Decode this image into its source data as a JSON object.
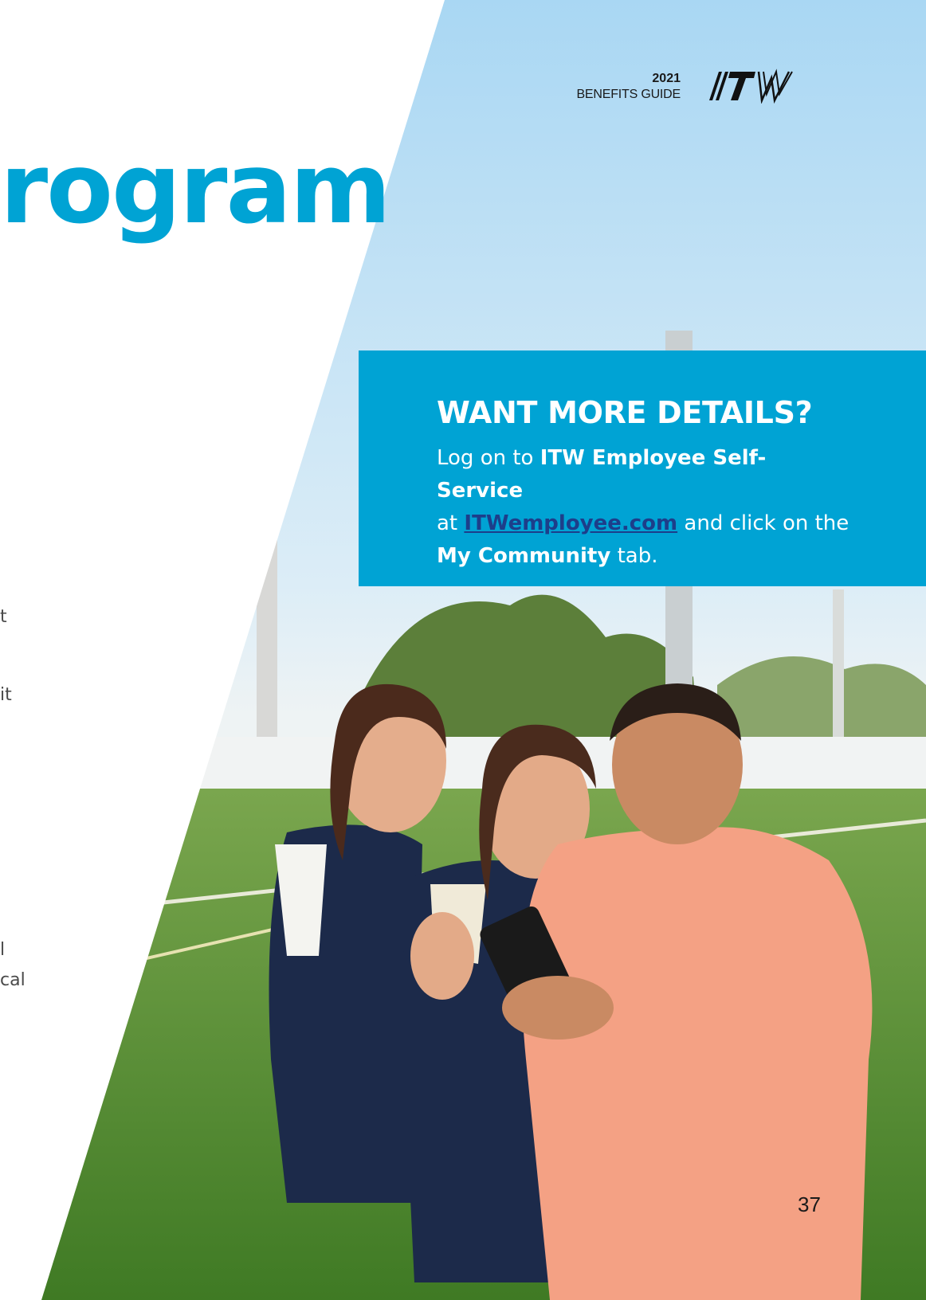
{
  "header": {
    "year": "2021",
    "guide_label": "BENEFITS GUIDE",
    "logo_text": "ITW"
  },
  "title_fragment": "rogram",
  "left_column_fragments": [
    "t",
    "l",
    "cal",
    "it"
  ],
  "callout": {
    "title": "WANT MORE DETAILS?",
    "line1_prefix": "Log on to ",
    "line1_bold": "ITW Employee Self-Service",
    "line2_prefix": "at ",
    "link_text": "ITWemployee.com",
    "line2_suffix": " and click on the",
    "line3_bold": "My Community",
    "line3_suffix": " tab."
  },
  "page_number": "37",
  "colors": {
    "accent": "#00a3d4",
    "link": "#1d3e8a",
    "shirt": "#f4a184",
    "grass": "#4f8a2e"
  }
}
